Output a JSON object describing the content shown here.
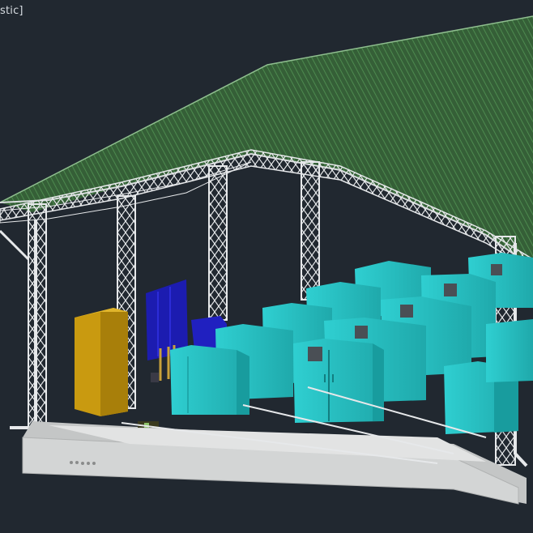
{
  "viewport": {
    "label": "stic]"
  },
  "colors": {
    "background": "#212830",
    "roof_green": "#3c6b3e",
    "truss_white": "#e6e8ea",
    "cabinet_cyan": "#2ec4c6",
    "cabinet_blue": "#1a1aa8",
    "cabinet_gold": "#c99a10",
    "platform_gray": "#cfd1d1"
  },
  "scene_objects": [
    "roof",
    "steel-truss-frame",
    "cyan-cabinets",
    "blue-equipment",
    "gold-cabinet",
    "concrete-platform"
  ]
}
